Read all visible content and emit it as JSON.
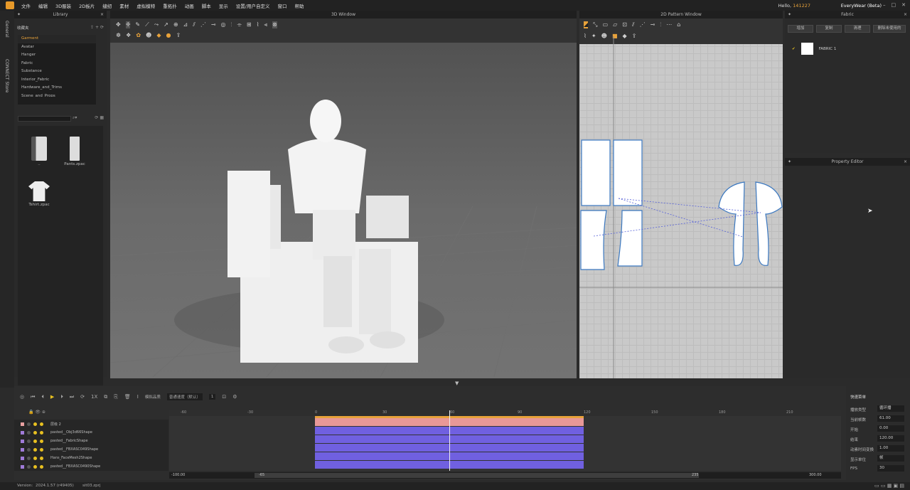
{
  "menubar": {
    "items": [
      "文件",
      "编辑",
      "3D服装",
      "2D板片",
      "缝纫",
      "素材",
      "虚拟模特",
      "重拓扑",
      "动画",
      "脚本",
      "显示",
      "设置/用户自定义",
      "窗口",
      "帮助"
    ],
    "hello_prefix": "Hello,",
    "user_id": "141227",
    "app_name": "EveryWear (Beta)"
  },
  "sidestrip": {
    "tab1": "General",
    "tab2": "CONNECT Store"
  },
  "library": {
    "title": "Library",
    "favorites": "收藏夹",
    "tree": [
      "Garment",
      "Avatar",
      "Hanger",
      "Fabric",
      "Substance",
      "Interior_Fabric",
      "Hardware_and_Trims",
      "Scene_and_Props"
    ],
    "files": [
      "..",
      "Pants.zpac",
      "Tshirt.zpac"
    ]
  },
  "window3d": {
    "title": "3D Window"
  },
  "window2d": {
    "title": "2D Pattern Window"
  },
  "fabric_panel": {
    "title": "Fabric",
    "buttons": [
      "增加",
      "复制",
      "清理",
      "删除未使用的"
    ],
    "item": "FABRIC 1"
  },
  "property_editor": {
    "title": "Property Editor"
  },
  "timeline": {
    "quality_label": "模拟品质",
    "quality_value": "普通速度（默认）",
    "step_value": "1",
    "ruler": [
      "-60",
      "-30",
      "0",
      "30",
      "60",
      "90",
      "120",
      "150",
      "180",
      "210"
    ],
    "tracks": [
      "层级 2",
      "pasted__Obj3d66Shape",
      "pasted__FabricShape",
      "pasted__FBXASC049Shape",
      "Hans_FaceMesh2Shape",
      "pasted__FBXASC0490Shape"
    ],
    "range_left": "-100.00",
    "range_start": "-65",
    "range_end": "235",
    "range_right": "300.00"
  },
  "fields": {
    "title": "快速菜单",
    "rows": [
      {
        "label": "播放类型",
        "value": "循环播"
      },
      {
        "label": "当前帧数",
        "value": "61.00"
      },
      {
        "label": "开始",
        "value": "0.00"
      },
      {
        "label": "结束",
        "value": "120.00"
      },
      {
        "label": "动素时间变换",
        "value": "1.00"
      },
      {
        "label": "显示单位",
        "value": "帧"
      },
      {
        "label": "FPS",
        "value": "30"
      }
    ]
  },
  "status": {
    "version": "Version:",
    "version_value": "2024.1.57 (r49405)",
    "file": "sit03.zprj"
  }
}
